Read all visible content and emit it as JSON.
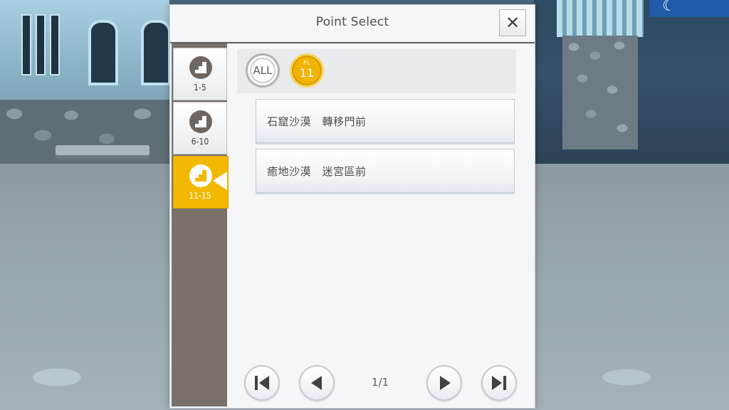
{
  "dialog": {
    "title": "Point Select",
    "close_icon": "close-icon",
    "close_glyph": "✕"
  },
  "sidebar": {
    "tabs": [
      {
        "label": "1-5",
        "icon": "stairs-icon",
        "active": false
      },
      {
        "label": "6-10",
        "icon": "stairs-icon",
        "active": false
      },
      {
        "label": "11-15",
        "icon": "stairs-icon",
        "active": true
      }
    ]
  },
  "filters": {
    "all_label": "ALL",
    "floor_prefix": "FL",
    "floor_number": "11",
    "selected": "floor"
  },
  "points": [
    "石窟沙漠　轉移門前",
    "癒地沙漠　迷宮區前"
  ],
  "pager": {
    "page_text": "1/1",
    "buttons": [
      "first-page",
      "prev-page",
      "next-page",
      "last-page"
    ]
  },
  "colors": {
    "accent": "#f2b800",
    "sidebar_bg": "#7a716b",
    "panel_bg": "#f4f6f8"
  }
}
